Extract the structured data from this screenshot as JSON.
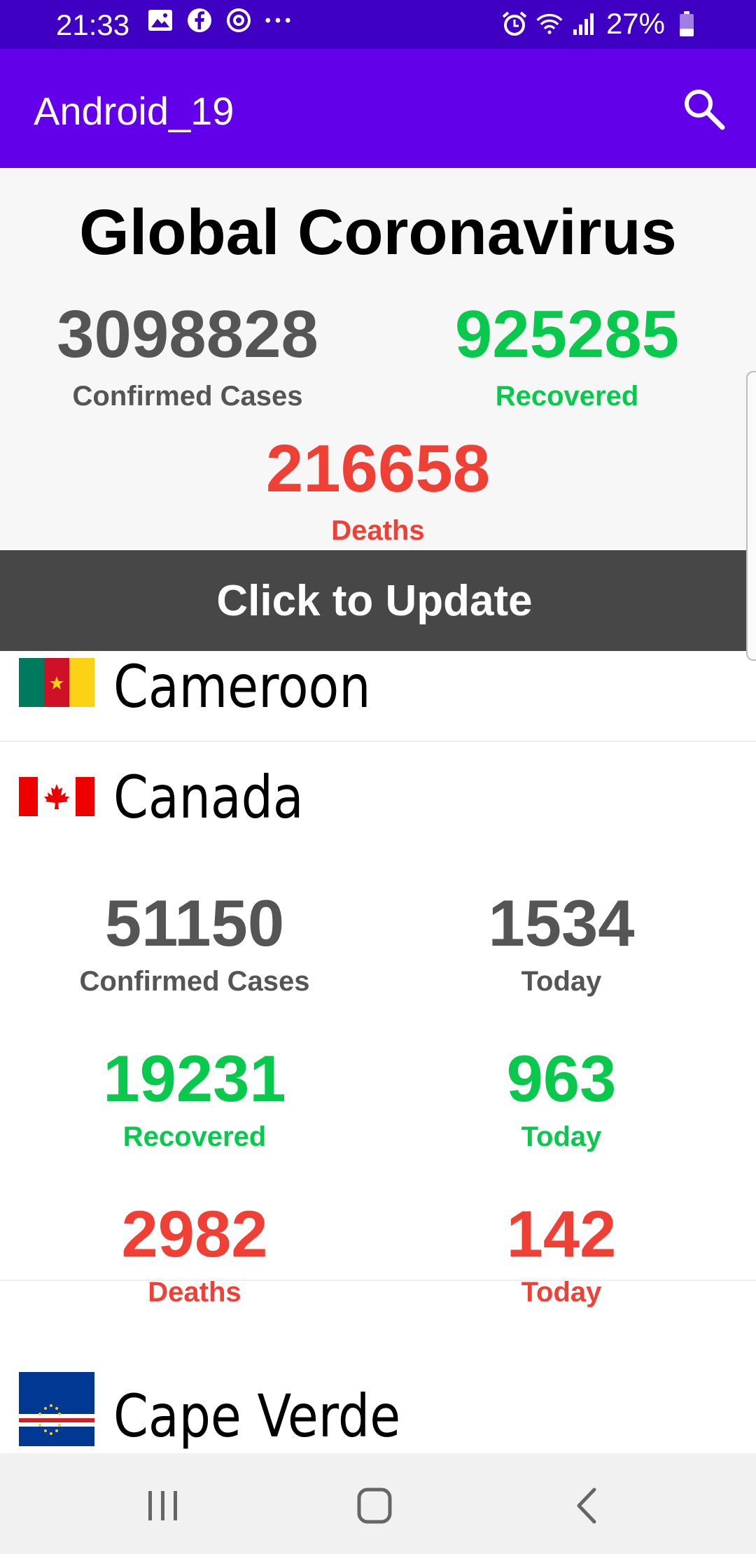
{
  "status_bar": {
    "time": "21:33",
    "battery": "27%",
    "left_icons": [
      "gallery-icon",
      "facebook-icon",
      "messenger-icon",
      "more-dots-icon"
    ],
    "right_icons": [
      "alarm-icon",
      "wifi-icon",
      "signal-icon",
      "battery-icon"
    ]
  },
  "app_bar": {
    "title": "Android_19",
    "color": "#6200ea"
  },
  "summary": {
    "heading": "Global Coronavirus",
    "confirmed": {
      "value": "3098828",
      "label": "Confirmed Cases"
    },
    "recovered": {
      "value": "925285",
      "label": "Recovered"
    },
    "deaths": {
      "value": "216658",
      "label": "Deaths"
    }
  },
  "update_button": {
    "label": "Click to Update"
  },
  "countries": [
    {
      "name": "Cameroon",
      "flag": "cameroon-flag"
    },
    {
      "name": "Canada",
      "flag": "canada-flag",
      "confirmed": {
        "value": "51150",
        "label": "Confirmed Cases"
      },
      "confirmed_today": {
        "value": "1534",
        "label": "Today"
      },
      "recovered": {
        "value": "19231",
        "label": "Recovered"
      },
      "recovered_today": {
        "value": "963",
        "label": "Today"
      },
      "deaths": {
        "value": "2982",
        "label": "Deaths"
      },
      "deaths_today": {
        "value": "142",
        "label": "Today"
      }
    },
    {
      "name": "Cape Verde",
      "flag": "cape-verde-flag"
    }
  ],
  "colors": {
    "confirmed": "#555555",
    "recovered": "#08c94c",
    "deaths": "#ef4036",
    "status_bar": "#3f00c4",
    "update_button": "#474747"
  },
  "nav_bar": [
    "recents-button",
    "home-button",
    "back-button"
  ]
}
